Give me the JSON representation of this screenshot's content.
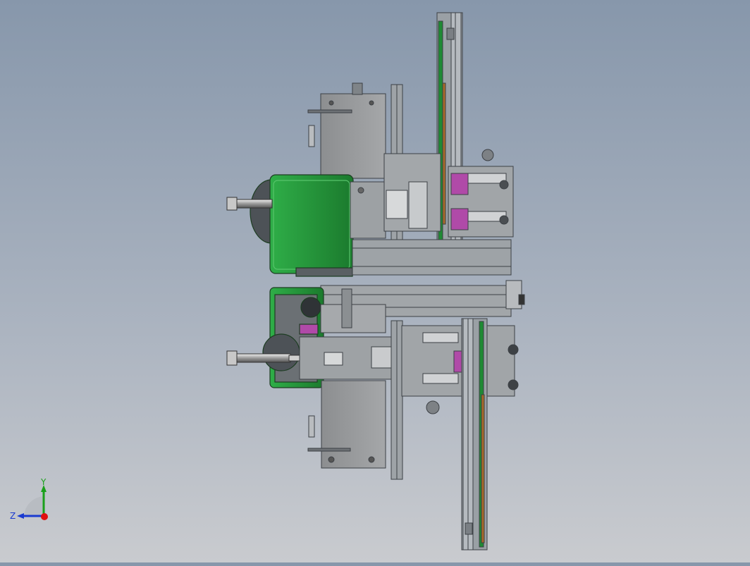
{
  "viewport": {
    "background_top": "#8797ab",
    "background_bottom": "#c9cbcf"
  },
  "triad": {
    "y_label": "Y",
    "z_label": "Z",
    "y_color": "#1aa01a",
    "z_color": "#1a3ad0",
    "x_color": "#e01010"
  },
  "colors": {
    "frame": "#8e9398",
    "frame_dark": "#4d5257",
    "plate": "#9a9c9e",
    "green": "#1f8a34",
    "green_light": "#2fae48",
    "magenta": "#b04aa8",
    "orange": "#a86a2a"
  }
}
